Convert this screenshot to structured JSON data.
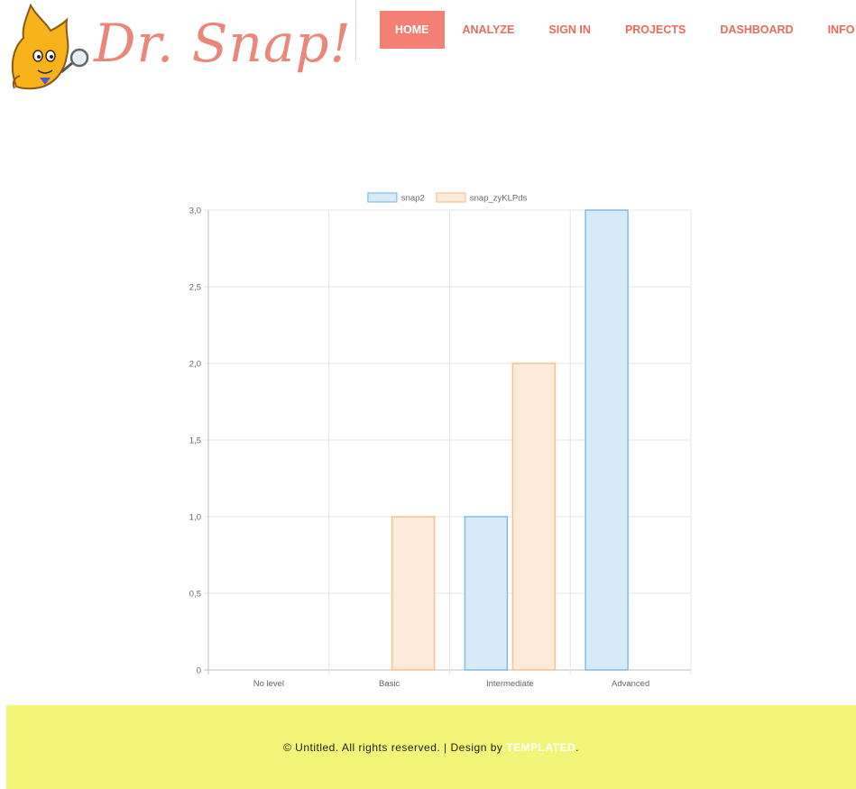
{
  "header": {
    "logo_text": "Dr. Snap!",
    "logo_icon": "cat-with-magnifier-icon",
    "nav": [
      {
        "label": "HOME",
        "active": true
      },
      {
        "label": "ANALYZE",
        "active": false
      },
      {
        "label": "SIGN IN",
        "active": false
      },
      {
        "label": "PROJECTS",
        "active": false
      },
      {
        "label": "DASHBOARD",
        "active": false
      },
      {
        "label": "INFO",
        "active": false
      }
    ]
  },
  "chart_data": {
    "type": "bar",
    "categories": [
      "No level",
      "Basic",
      "Intermediate",
      "Advanced"
    ],
    "series": [
      {
        "name": "snap2",
        "values": [
          0,
          0,
          1,
          3
        ],
        "fill": "#d6eaf8",
        "stroke": "#7fbde8"
      },
      {
        "name": "snap_zyKLPds",
        "values": [
          0,
          1,
          2,
          0
        ],
        "fill": "#fdebd9",
        "stroke": "#f6c28e"
      }
    ],
    "y_ticks": [
      "0",
      "0,5",
      "1,0",
      "1,5",
      "2,0",
      "2,5",
      "3,0"
    ],
    "ylim": [
      0,
      3
    ],
    "grid": true,
    "legend_position": "top"
  },
  "footer": {
    "text_before": "© Untitled. All rights reserved. | Design by ",
    "link_text": "TEMPLATED",
    "text_after": "."
  },
  "colors": {
    "accent": "#f47f75",
    "nav_text": "#ea6b5c",
    "footer_bg": "#f2f578",
    "logo_text": "#e9877b"
  }
}
